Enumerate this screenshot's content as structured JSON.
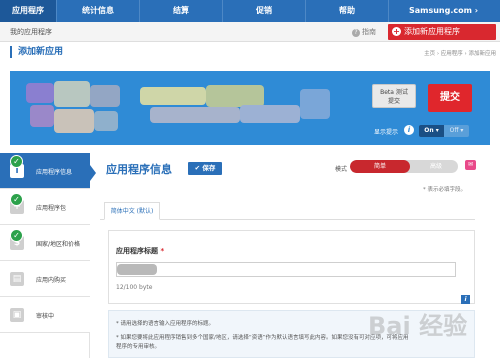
{
  "nav": {
    "items": [
      "应用程序",
      "统计信息",
      "结算",
      "促销",
      "帮助",
      "Samsung.com ›"
    ]
  },
  "subbar": {
    "my_apps": "我的应用程序",
    "guide": "指南",
    "add_app": "添加新应用程序"
  },
  "page": {
    "title": "添加新应用",
    "breadcrumb": "主页 › 应用程序 › 添加新应用"
  },
  "banner": {
    "beta_line1": "Beta 测试",
    "beta_line2": "提交",
    "submit": "提交",
    "show_hint": "显示提示",
    "toggle_on": "On ▾",
    "toggle_off": "Off ▾"
  },
  "sidebar": {
    "items": [
      {
        "label": "应用程序信息",
        "icon": "info-icon",
        "checked": true,
        "active": true
      },
      {
        "label": "应用程序包",
        "icon": "package-icon",
        "checked": true,
        "active": false
      },
      {
        "label": "国家/地区和价格",
        "icon": "dollar-icon",
        "checked": true,
        "active": false
      },
      {
        "label": "应用内购买",
        "icon": "purchase-icon",
        "checked": false,
        "active": false
      },
      {
        "label": "审核中",
        "icon": "review-icon",
        "checked": false,
        "active": false
      }
    ]
  },
  "main": {
    "section_title": "应用程序信息",
    "save": "✔ 保存",
    "mode_label": "模式",
    "mode_simple": "简单",
    "mode_advanced": "高级",
    "required_note": "* 表示必填字段。",
    "tab_active": "简体中文 (默认)",
    "field_label": "应用程序标题",
    "field_required": "*",
    "char_count": "12/100 byte",
    "notes": [
      "* 请用选择的语言输入应用程序的标题。",
      "* 如果您要将此应用程序销售到多个国家/地区，请选择“资语”作为默认语言填写此内容。如果您没有可对应项，可将应用",
      "  程序的专用审核。"
    ]
  },
  "watermark": "Bai 经验",
  "colors": {
    "brand_blue": "#2a6fb8",
    "accent_red": "#d9282f",
    "success_green": "#2ca14b"
  }
}
